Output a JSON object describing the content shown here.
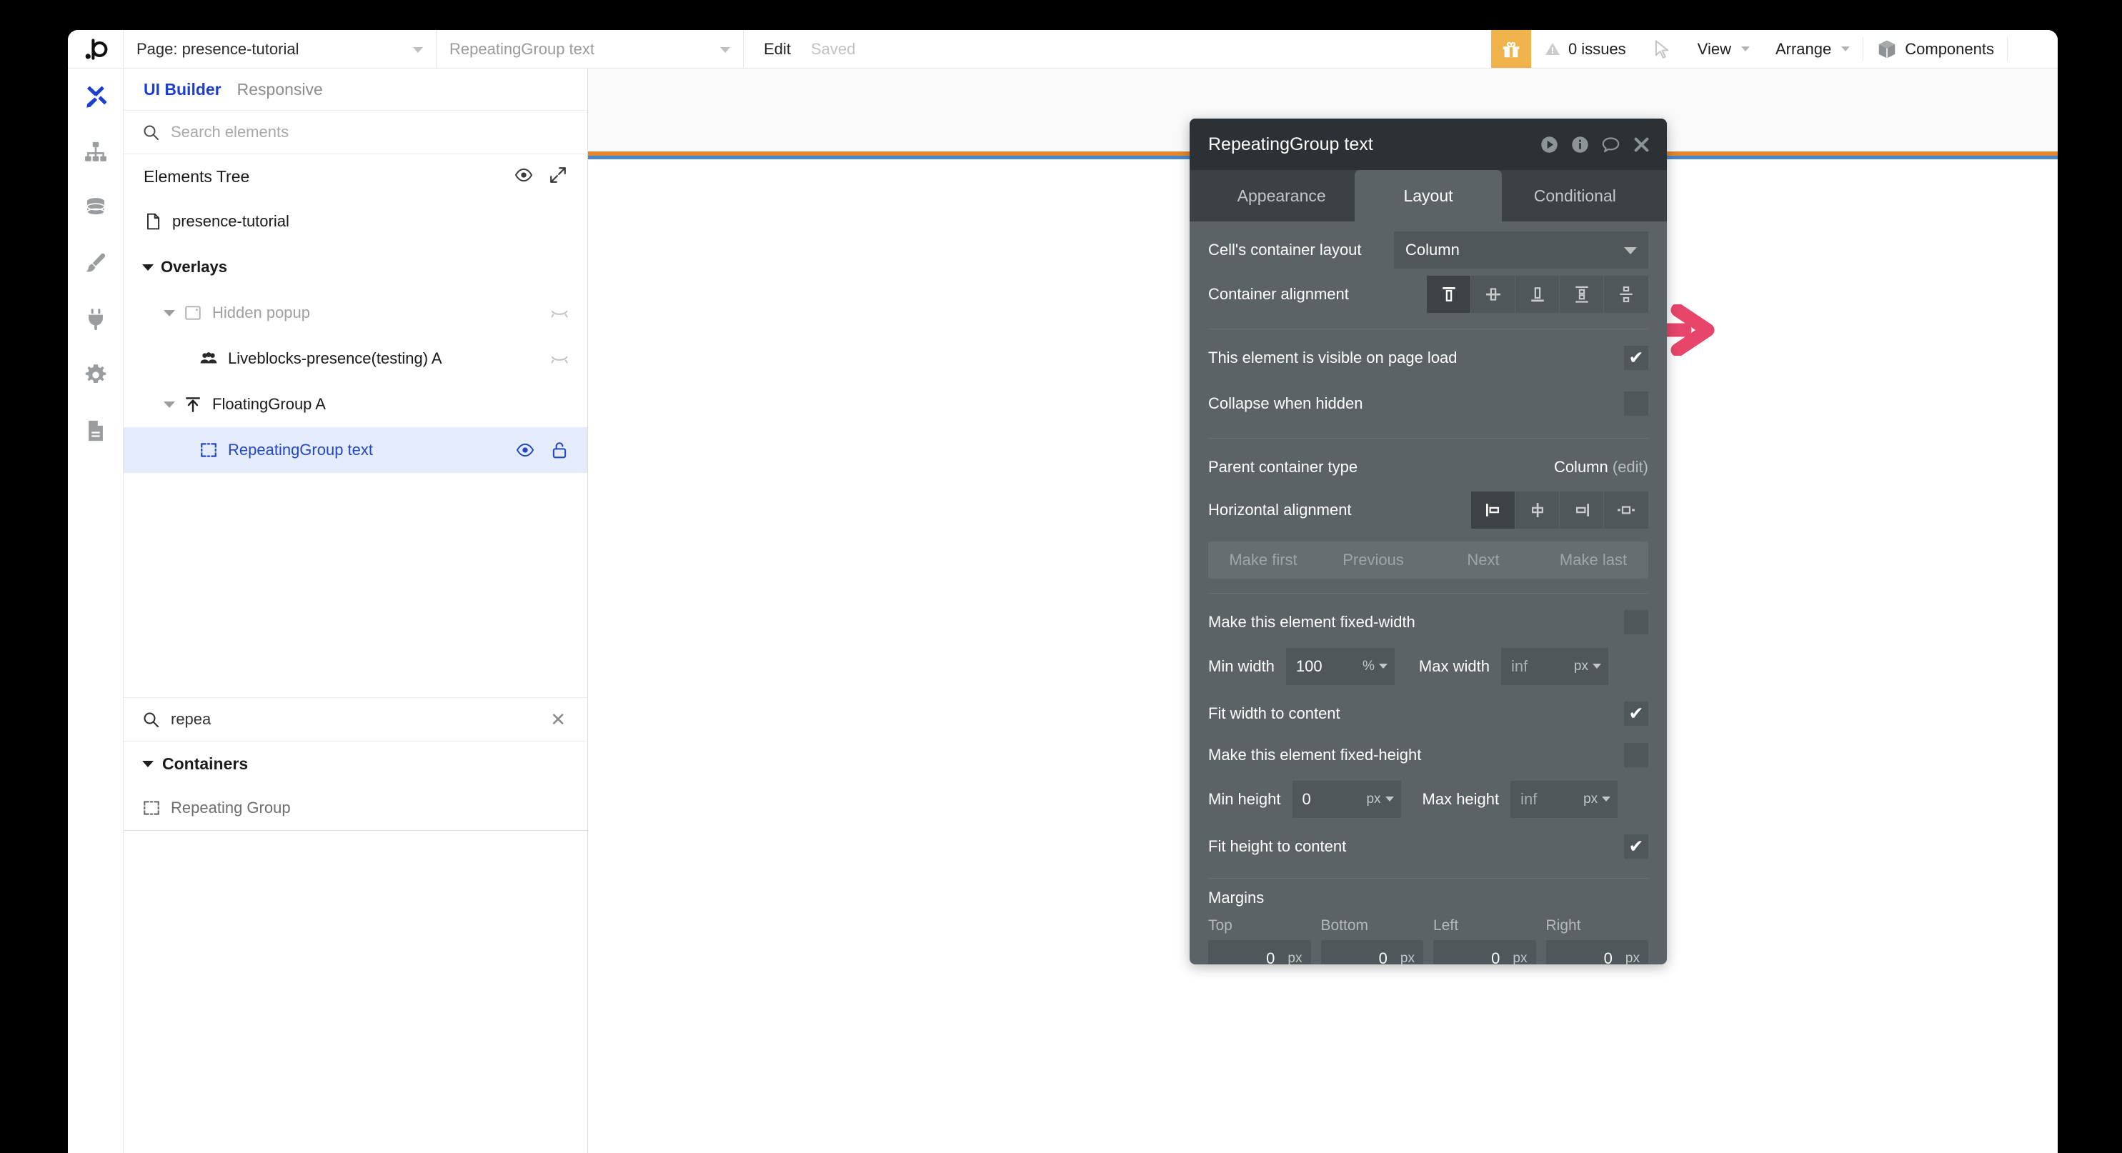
{
  "topbar": {
    "logo": "bubble-logo",
    "page_select": "Page: presence-tutorial",
    "element_select": "RepeatingGroup text",
    "edit_label": "Edit",
    "saved_label": "Saved",
    "gift_icon": "gift-icon",
    "issues_label": "0 issues",
    "issues_icon": "warning-icon",
    "cursor_icon": "cursor-arrow-icon",
    "view_label": "View",
    "arrange_label": "Arrange",
    "components_label": "Components",
    "components_icon": "cube-icon"
  },
  "rail": {
    "items": [
      {
        "name": "design-tab",
        "icon": "pencil-ruler-icon",
        "active": true
      },
      {
        "name": "workflow-tab",
        "icon": "sitemap-icon",
        "active": false
      },
      {
        "name": "data-tab",
        "icon": "database-icon",
        "active": false
      },
      {
        "name": "styles-tab",
        "icon": "paintbrush-icon",
        "active": false
      },
      {
        "name": "plugins-tab",
        "icon": "plug-icon",
        "active": false
      },
      {
        "name": "settings-tab",
        "icon": "gear-icon",
        "active": false
      },
      {
        "name": "logs-tab",
        "icon": "document-icon",
        "active": false
      }
    ]
  },
  "left_panel": {
    "tab_ui_builder": "UI Builder",
    "tab_responsive": "Responsive",
    "search_placeholder": "Search elements",
    "search_value": "",
    "tree_title": "Elements Tree",
    "tree_eye_icon": "eye-icon",
    "tree_expand_icon": "expand-arrows-icon",
    "tree": [
      {
        "label": "presence-tutorial",
        "icon": "page-icon",
        "indent": 0,
        "twisty": "none",
        "dim": false,
        "bold": false,
        "selected": false,
        "right": []
      },
      {
        "label": "Overlays",
        "icon": "none",
        "indent": 0,
        "twisty": "open",
        "dim": false,
        "bold": true,
        "selected": false,
        "right": []
      },
      {
        "label": "Hidden popup",
        "icon": "popup-icon",
        "indent": 1,
        "twisty": "open",
        "dim": true,
        "bold": false,
        "selected": false,
        "right": [
          "eye-slash-icon"
        ]
      },
      {
        "label": "Liveblocks-presence(testing) A",
        "icon": "users-icon",
        "indent": 2,
        "twisty": "none",
        "dim": false,
        "bold": false,
        "selected": false,
        "right": [
          "eye-slash-icon"
        ]
      },
      {
        "label": "FloatingGroup A",
        "icon": "float-group-icon",
        "indent": 0,
        "twisty": "open-dim",
        "dim": false,
        "bold": false,
        "selected": false,
        "right": []
      },
      {
        "label": "RepeatingGroup text",
        "icon": "repeating-group-icon",
        "indent": 2,
        "twisty": "none",
        "dim": false,
        "bold": false,
        "selected": true,
        "right": [
          "eye-icon",
          "unlock-icon"
        ]
      }
    ],
    "palette_search_value": "repea",
    "palette_clear_icon": "clear-x-icon",
    "palette_group": "Containers",
    "palette_items": [
      {
        "label": "Repeating Group",
        "icon": "repeating-group-icon"
      }
    ]
  },
  "property_panel": {
    "title": "RepeatingGroup text",
    "header_icons": [
      "play-icon",
      "info-icon",
      "comment-icon",
      "close-icon"
    ],
    "tabs": [
      {
        "label": "Appearance",
        "active": false
      },
      {
        "label": "Layout",
        "active": true
      },
      {
        "label": "Conditional",
        "active": false
      }
    ],
    "cell_container_layout_label": "Cell's container layout",
    "cell_container_layout_value": "Column",
    "container_alignment_label": "Container alignment",
    "container_alignment_options": [
      {
        "name": "align-top",
        "active": true
      },
      {
        "name": "align-center",
        "active": false
      },
      {
        "name": "align-bottom",
        "active": false
      },
      {
        "name": "align-space-between",
        "active": false
      },
      {
        "name": "align-space-around",
        "active": false
      }
    ],
    "visible_on_page_load_label": "This element is visible on page load",
    "visible_on_page_load_checked": true,
    "collapse_when_hidden_label": "Collapse when hidden",
    "collapse_when_hidden_checked": false,
    "parent_container_type_label": "Parent container type",
    "parent_container_type_value": "Column",
    "parent_container_edit": "(edit)",
    "horizontal_alignment_label": "Horizontal alignment",
    "horizontal_alignment_options": [
      {
        "name": "h-align-left",
        "active": true
      },
      {
        "name": "h-align-center",
        "active": false
      },
      {
        "name": "h-align-right",
        "active": false
      },
      {
        "name": "h-align-spread",
        "active": false
      }
    ],
    "order_buttons": [
      "Make first",
      "Previous",
      "Next",
      "Make last"
    ],
    "fixed_width_label": "Make this element fixed-width",
    "fixed_width_checked": false,
    "min_width_label": "Min width",
    "min_width_value": "100",
    "min_width_unit": "%",
    "max_width_label": "Max width",
    "max_width_value": "inf",
    "max_width_unit": "px",
    "fit_width_label": "Fit width to content",
    "fit_width_checked": true,
    "fixed_height_label": "Make this element fixed-height",
    "fixed_height_checked": false,
    "min_height_label": "Min height",
    "min_height_value": "0",
    "min_height_unit": "px",
    "max_height_label": "Max height",
    "max_height_value": "inf",
    "max_height_unit": "px",
    "fit_height_label": "Fit height to content",
    "fit_height_checked": true,
    "margins_label": "Margins",
    "margins": [
      {
        "label": "Top",
        "value": "0",
        "unit": "px"
      },
      {
        "label": "Bottom",
        "value": "0",
        "unit": "px"
      },
      {
        "label": "Left",
        "value": "0",
        "unit": "px"
      },
      {
        "label": "Right",
        "value": "0",
        "unit": "px"
      }
    ]
  },
  "annotations": {
    "arrow_color": "#E8456B",
    "straight_arrow": "annotation-arrow-straight",
    "curved_arrow": "annotation-arrow-curved"
  },
  "colors": {
    "accent_blue": "#1b3fd1",
    "panel_bg": "#5B6367",
    "panel_header": "#2B3134",
    "gift_yellow": "#F0B24B",
    "canvas_orange": "#E3872E",
    "canvas_blue": "#4A86C8"
  }
}
